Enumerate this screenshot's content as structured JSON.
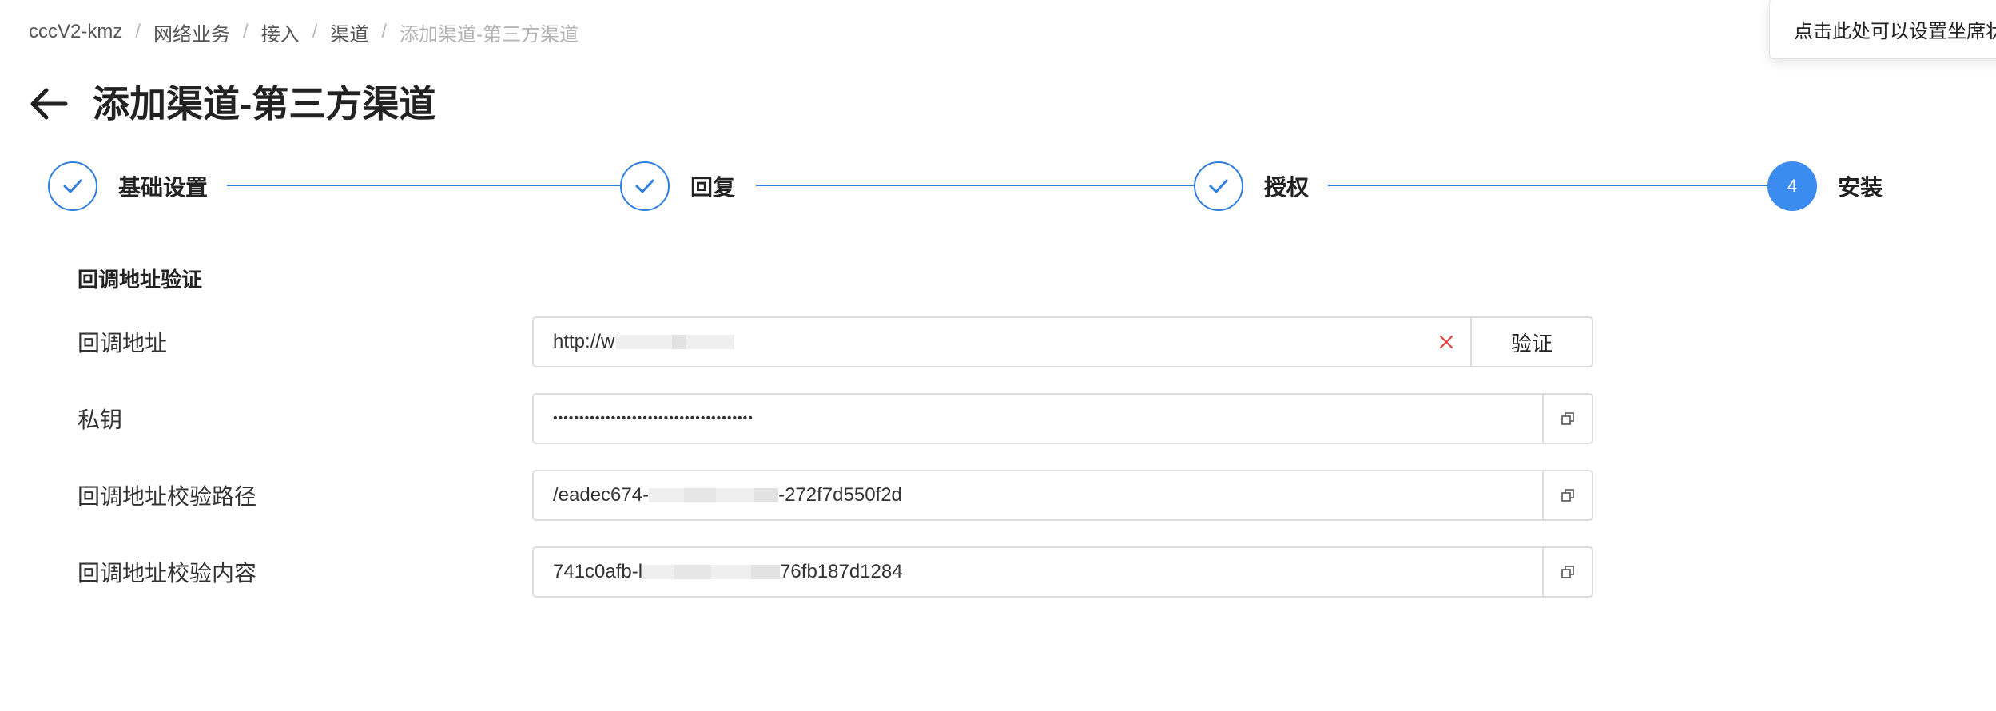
{
  "breadcrumb": {
    "items": [
      "cccV2-kmz",
      "网络业务",
      "接入",
      "渠道",
      "添加渠道-第三方渠道"
    ],
    "separator": "/"
  },
  "popover": {
    "text": "点击此处可以设置坐席状态"
  },
  "header": {
    "title": "添加渠道-第三方渠道",
    "back_icon": "arrow-left-icon"
  },
  "steps": [
    {
      "label": "基础设置",
      "status": "done",
      "icon": "check-icon"
    },
    {
      "label": "回复",
      "status": "done",
      "icon": "check-icon"
    },
    {
      "label": "授权",
      "status": "done",
      "icon": "check-icon"
    },
    {
      "label": "安装",
      "status": "active",
      "number": "4"
    }
  ],
  "section": {
    "title": "回调地址验证",
    "fields": [
      {
        "label": "回调地址",
        "value_prefix": "http://w",
        "action": "验证",
        "clearable": true
      },
      {
        "label": "私钥",
        "value": "••••••••••••••••••••••••••••••••••••••",
        "action_icon": "copy-icon"
      },
      {
        "label": "回调地址校验路径",
        "value_prefix": "/eadec674-",
        "value_suffix": "-272f7d550f2d",
        "action_icon": "copy-icon"
      },
      {
        "label": "回调地址校验内容",
        "value_prefix": "741c0afb-l",
        "value_suffix": "76fb187d1284",
        "action_icon": "copy-icon"
      }
    ]
  },
  "colors": {
    "primary": "#2f7fe0",
    "active_step": "#3b8bf0",
    "clear": "#e0443e"
  }
}
